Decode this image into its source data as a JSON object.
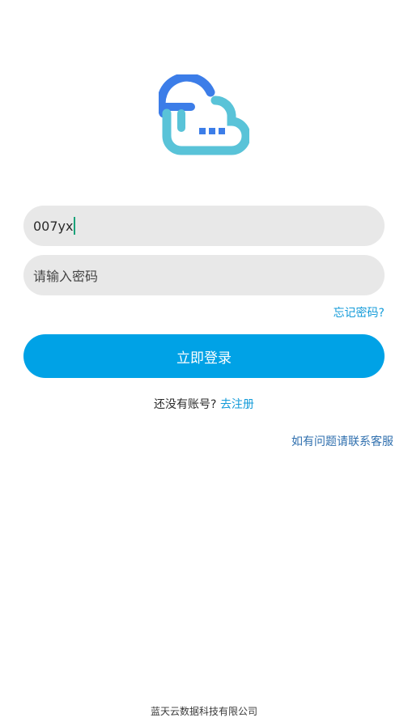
{
  "login": {
    "username_value": "007yx",
    "password_placeholder": "请输入密码",
    "forgot_password": "忘记密码?",
    "login_button": "立即登录",
    "no_account_prompt": "还没有账号?",
    "register_link": "去注册",
    "support_link": "如有问题请联系客服"
  },
  "footer": {
    "company": "蓝天云数据科技有限公司"
  },
  "colors": {
    "accent": "#00a2e6",
    "link": "#139bd9",
    "logo_blue": "#3c7de8",
    "logo_cyan": "#59c3d8"
  }
}
